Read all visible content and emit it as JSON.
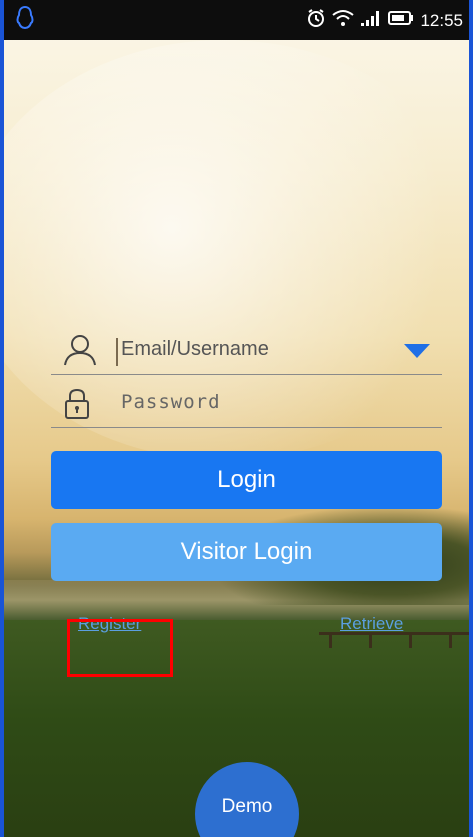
{
  "status_bar": {
    "time": "12:55",
    "left_icon": "qq-penguin-icon",
    "right_icons": [
      "alarm-icon",
      "wifi-icon",
      "signal-icon",
      "battery-icon"
    ]
  },
  "login_form": {
    "username_placeholder": "Email/Username",
    "password_placeholder": "Password",
    "login_label": "Login",
    "visitor_label": "Visitor Login"
  },
  "links": {
    "register": "Register",
    "retrieve": "Retrieve"
  },
  "demo_label": "Demo",
  "colors": {
    "primary": "#1877f2",
    "secondary": "#5aaaf2",
    "link": "#5b9fe0",
    "highlight": "#ff0000"
  }
}
